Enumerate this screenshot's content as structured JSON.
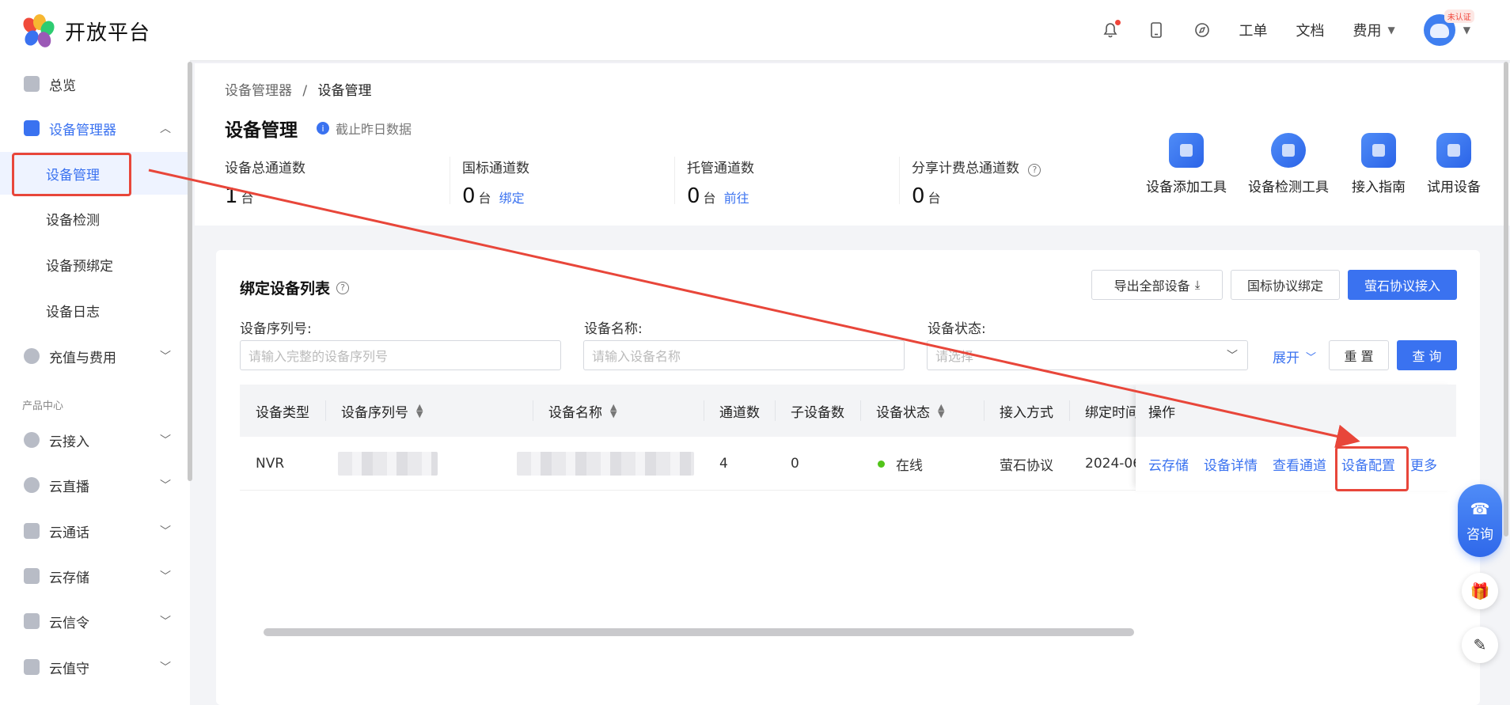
{
  "header": {
    "logo_text": "开放平台",
    "links": [
      "工单",
      "文档"
    ],
    "fee_label": "费用",
    "auth_badge": "未认证",
    "icons": [
      "bell-icon",
      "phone-icon",
      "compass-icon"
    ]
  },
  "sidebar": {
    "overview": "总览",
    "device_manager": "设备管理器",
    "sub_items": [
      "设备管理",
      "设备检测",
      "设备预绑定",
      "设备日志"
    ],
    "recharge": "充值与费用",
    "section_label": "产品中心",
    "products": [
      "云接入",
      "云直播",
      "云通话",
      "云存储",
      "云信令",
      "云值守"
    ]
  },
  "breadcrumb": {
    "parent": "设备管理器",
    "separator": "/",
    "current": "设备管理"
  },
  "page": {
    "title": "设备管理",
    "note": "截止昨日数据"
  },
  "stats": [
    {
      "label": "设备总通道数",
      "value": "1",
      "unit": "台",
      "link": ""
    },
    {
      "label": "国标通道数",
      "value": "0",
      "unit": "台",
      "link": "绑定"
    },
    {
      "label": "托管通道数",
      "value": "0",
      "unit": "台",
      "link": "前往"
    },
    {
      "label": "分享计费总通道数",
      "value": "0",
      "unit": "台",
      "link": ""
    }
  ],
  "tools": [
    "设备添加工具",
    "设备检测工具",
    "接入指南",
    "试用设备"
  ],
  "list": {
    "title": "绑定设备列表",
    "buttons": {
      "export": "导出全部设备",
      "gb_bind": "国标协议绑定",
      "ezviz_access": "萤石协议接入"
    },
    "filters": {
      "serial_label": "设备序列号:",
      "serial_placeholder": "请输入完整的设备序列号",
      "name_label": "设备名称:",
      "name_placeholder": "请输入设备名称",
      "status_label": "设备状态:",
      "status_placeholder": "请选择"
    },
    "expand": "展开",
    "reset": "重 置",
    "query": "查 询",
    "columns": [
      "设备类型",
      "设备序列号",
      "设备名称",
      "通道数",
      "子设备数",
      "设备状态",
      "接入方式",
      "绑定时间",
      "操作"
    ],
    "rows": [
      {
        "type": "NVR",
        "channels": "4",
        "sub_devices": "0",
        "status": "在线",
        "access": "萤石协议",
        "bind_time": "2024-06"
      }
    ],
    "operations": [
      "云存储",
      "设备详情",
      "查看通道",
      "设备配置",
      "更多"
    ]
  },
  "floating": {
    "consult": "咨询"
  },
  "colors": {
    "accent": "#3a72f0",
    "annotation": "#e8463a",
    "online": "#52c41a"
  }
}
